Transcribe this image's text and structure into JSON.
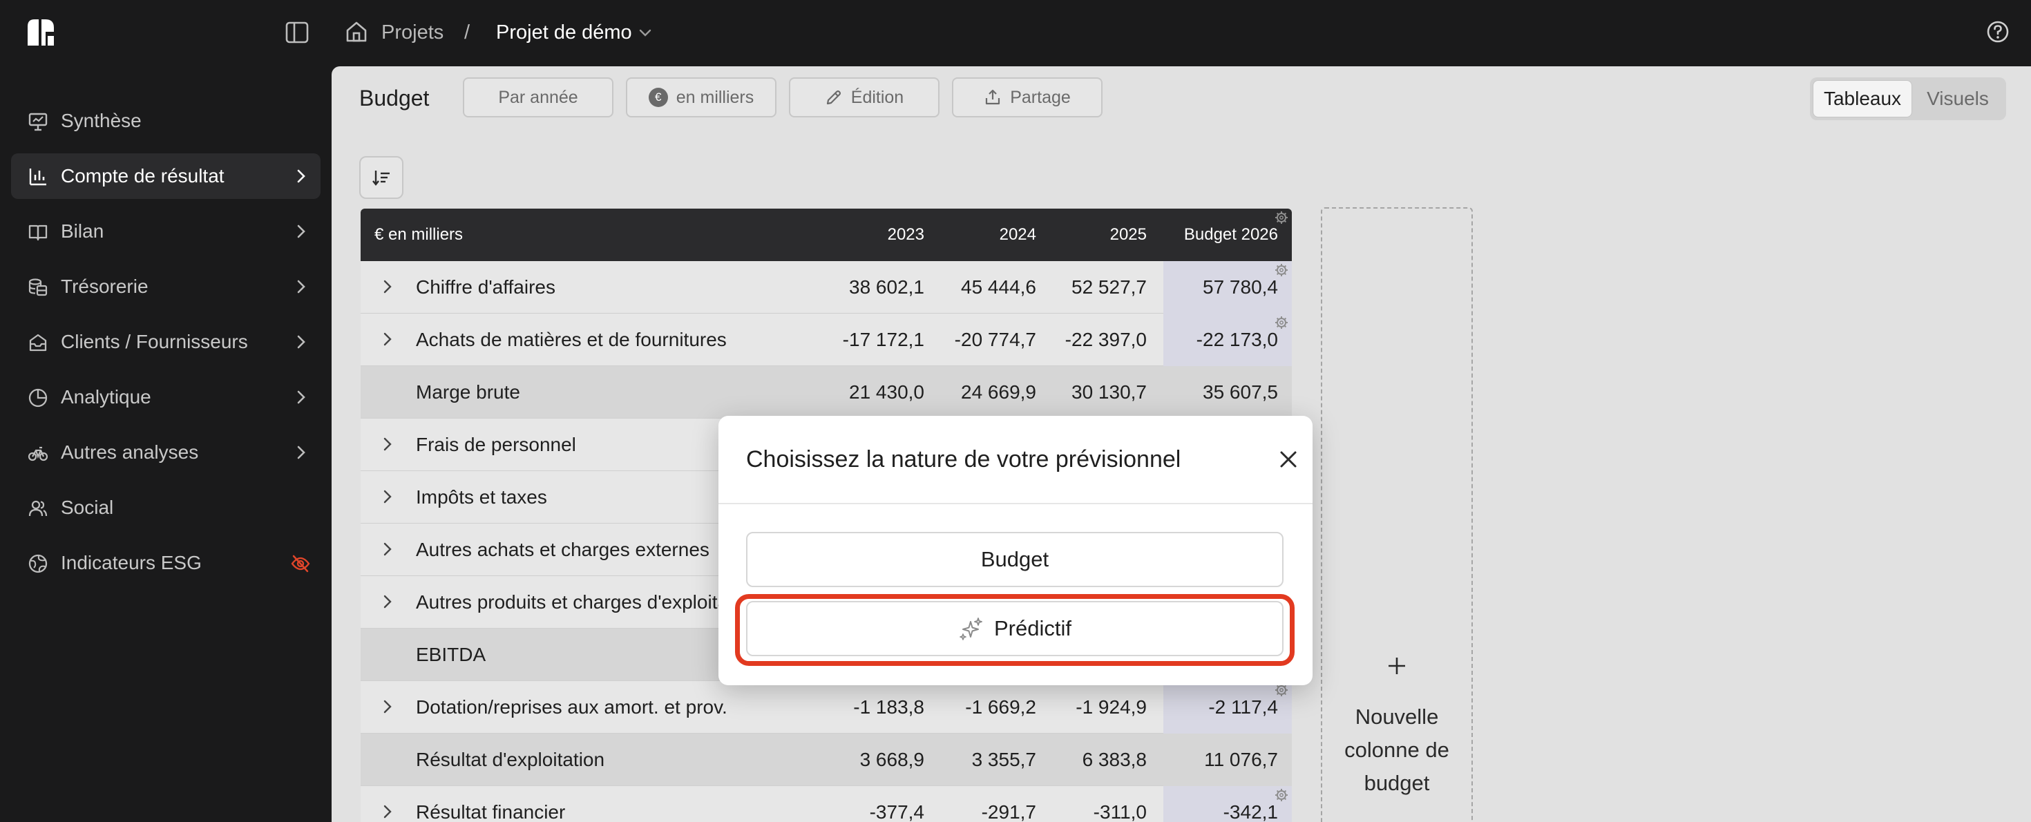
{
  "breadcrumb": {
    "root": "Projets",
    "separator": "/",
    "current": "Projet de démo"
  },
  "sidebar": {
    "items": [
      {
        "label": "Synthèse",
        "icon": "presentation-icon",
        "chevron": false,
        "active": false
      },
      {
        "label": "Compte de résultat",
        "icon": "bar-chart-icon",
        "chevron": true,
        "active": true
      },
      {
        "label": "Bilan",
        "icon": "book-icon",
        "chevron": true,
        "active": false
      },
      {
        "label": "Trésorerie",
        "icon": "coins-icon",
        "chevron": true,
        "active": false
      },
      {
        "label": "Clients / Fournisseurs",
        "icon": "inbox-icon",
        "chevron": true,
        "active": false
      },
      {
        "label": "Analytique",
        "icon": "pie-chart-icon",
        "chevron": true,
        "active": false
      },
      {
        "label": "Autres analyses",
        "icon": "bike-icon",
        "chevron": true,
        "active": false
      },
      {
        "label": "Social",
        "icon": "users-icon",
        "chevron": false,
        "active": false
      },
      {
        "label": "Indicateurs ESG",
        "icon": "globe-icon",
        "chevron": false,
        "active": false,
        "badge": "eye-off-icon"
      }
    ]
  },
  "toolbar": {
    "title": "Budget",
    "by_year": "Par année",
    "currency_symbol": "€",
    "units": "en milliers",
    "edit": "Édition",
    "share": "Partage",
    "view_tables": "Tableaux",
    "view_visuals": "Visuels"
  },
  "table": {
    "header": {
      "label": "€ en milliers",
      "y2023": "2023",
      "y2024": "2024",
      "y2025": "2025",
      "budget": "Budget 2026"
    },
    "rows": [
      {
        "label": "Chiffre d'affaires",
        "y2023": "38 602,1",
        "y2024": "45 444,6",
        "y2025": "52 527,7",
        "budget": "57 780,4",
        "expandable": true,
        "subtotal": false
      },
      {
        "label": "Achats de matières et de fournitures",
        "y2023": "-17 172,1",
        "y2024": "-20 774,7",
        "y2025": "-22 397,0",
        "budget": "-22 173,0",
        "expandable": true,
        "subtotal": false
      },
      {
        "label": "Marge brute",
        "y2023": "21 430,0",
        "y2024": "24 669,9",
        "y2025": "30 130,7",
        "budget": "35 607,5",
        "expandable": false,
        "subtotal": true
      },
      {
        "label": "Frais de personnel",
        "y2023": "",
        "y2024": "",
        "y2025": "",
        "budget": "",
        "expandable": true,
        "subtotal": false
      },
      {
        "label": "Impôts et taxes",
        "y2023": "",
        "y2024": "",
        "y2025": "",
        "budget": "",
        "expandable": true,
        "subtotal": false
      },
      {
        "label": "Autres achats et charges externes",
        "y2023": "",
        "y2024": "",
        "y2025": "",
        "budget": "",
        "expandable": true,
        "subtotal": false
      },
      {
        "label": "Autres produits et charges d'exploitation",
        "y2023": "",
        "y2024": "",
        "y2025": "",
        "budget": "",
        "expandable": true,
        "subtotal": false
      },
      {
        "label": "EBITDA",
        "y2023": "",
        "y2024": "",
        "y2025": "",
        "budget": "",
        "expandable": false,
        "subtotal": true
      },
      {
        "label": "Dotation/reprises aux amort. et prov.",
        "y2023": "-1 183,8",
        "y2024": "-1 669,2",
        "y2025": "-1 924,9",
        "budget": "-2 117,4",
        "expandable": true,
        "subtotal": false
      },
      {
        "label": "Résultat d'exploitation",
        "y2023": "3 668,9",
        "y2024": "3 355,7",
        "y2025": "6 383,8",
        "budget": "11 076,7",
        "expandable": false,
        "subtotal": true
      },
      {
        "label": "Résultat financier",
        "y2023": "-377,4",
        "y2024": "-291,7",
        "y2025": "-311,0",
        "budget": "-342,1",
        "expandable": true,
        "subtotal": false
      }
    ]
  },
  "add_column": {
    "plus": "+",
    "label_line1": "Nouvelle",
    "label_line2": "colonne de",
    "label_line3": "budget"
  },
  "modal": {
    "title": "Choisissez la nature de votre prévisionnel",
    "option_budget": "Budget",
    "option_predictive": "Prédictif"
  },
  "colors": {
    "highlight": "#e23a20",
    "badge_red": "#e0452a"
  }
}
